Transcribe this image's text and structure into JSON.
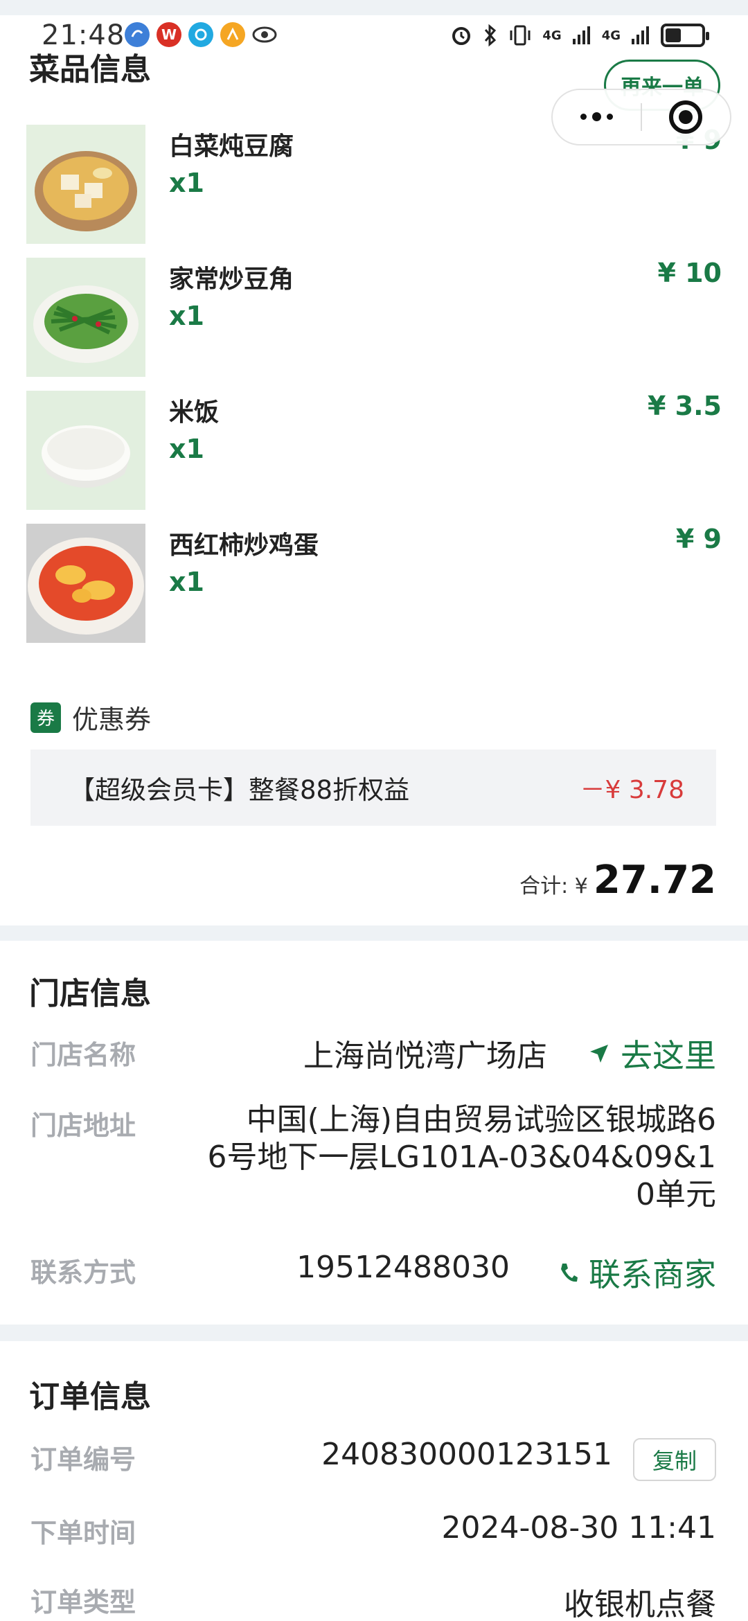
{
  "status_bar": {
    "time": "21:48",
    "app_icons": [
      "blue-app-icon",
      "wps-icon",
      "browser-icon",
      "game-icon",
      "eye-icon"
    ],
    "wps_letter": "W",
    "network_label_1": "4G",
    "network_label_2": "4G"
  },
  "dishes": {
    "title": "菜品信息",
    "reorder_label": "再来一单",
    "items": [
      {
        "name": "白菜炖豆腐",
        "qty": "x1",
        "price": "¥ 9"
      },
      {
        "name": "家常炒豆角",
        "qty": "x1",
        "price": "¥ 10"
      },
      {
        "name": "米饭",
        "qty": "x1",
        "price": "¥ 3.5"
      },
      {
        "name": "西红柿炒鸡蛋",
        "qty": "x1",
        "price": "¥ 9"
      }
    ]
  },
  "coupon": {
    "tag": "券",
    "label": "优惠券",
    "text": "【超级会员卡】整餐88折权益",
    "amount": "－¥ 3.78"
  },
  "total": {
    "label": "合计: ¥",
    "value": "27.72"
  },
  "store": {
    "title": "门店信息",
    "name_label": "门店名称",
    "name_value": "上海尚悦湾广场店",
    "navigate_label": "去这里",
    "address_label": "门店地址",
    "address_lines": [
      "中国(上海)自由贸易试验区银城路6",
      "6号地下一层LG101A-03&04&09&1",
      "0单元"
    ],
    "contact_label": "联系方式",
    "contact_value": "19512488030",
    "contact_link": "联系商家"
  },
  "order": {
    "title": "订单信息",
    "number_label": "订单编号",
    "number_value": "240830000123151",
    "copy_label": "复制",
    "time_label": "下单时间",
    "time_value": "2024-08-30 11:41",
    "type_label": "订单类型",
    "type_value": "收银机点餐"
  },
  "colors": {
    "brand_green": "#1a7a46",
    "discount_red": "#d83b3b",
    "muted_label": "#a8abb0",
    "page_bg": "#eef2f5"
  }
}
